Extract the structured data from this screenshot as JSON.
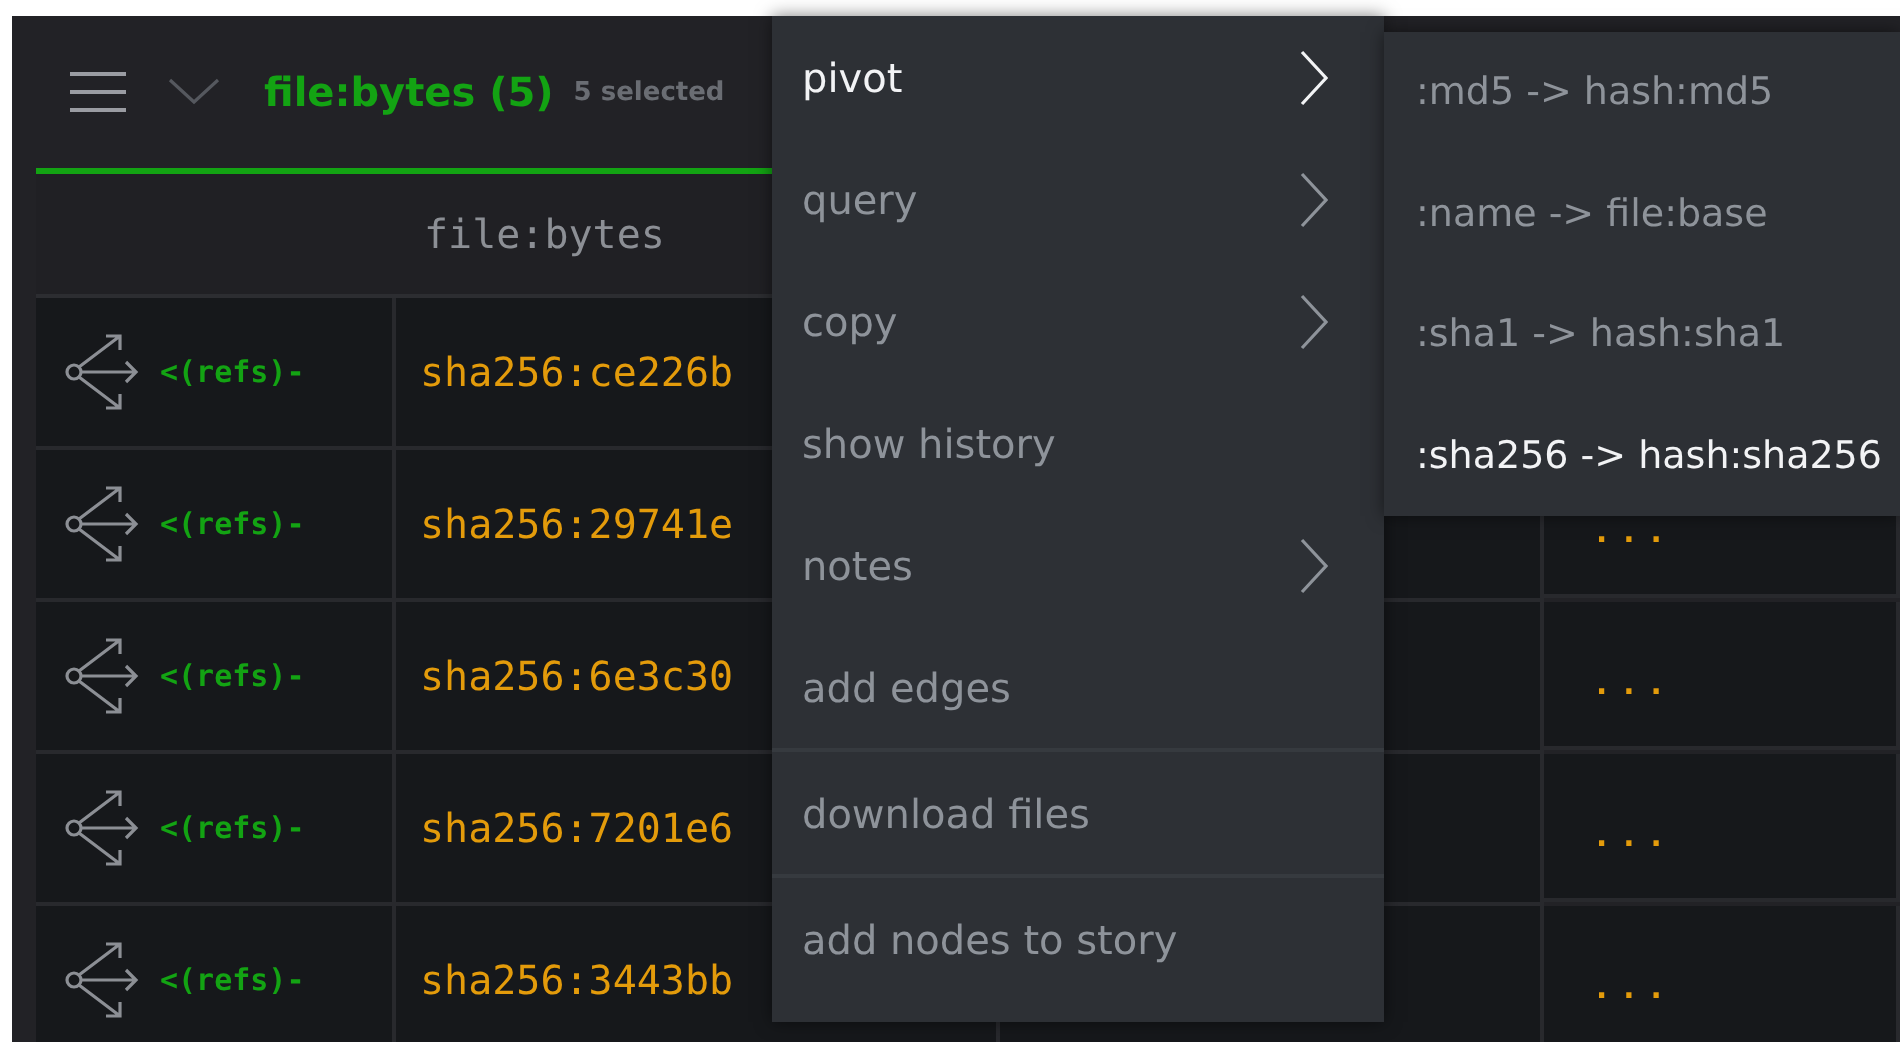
{
  "header": {
    "title": "file:bytes (5)",
    "selection": "5 selected"
  },
  "table": {
    "column_header": "file:bytes",
    "rows": [
      {
        "refs": "<(refs)-",
        "hash": "sha256:ce226b"
      },
      {
        "refs": "<(refs)-",
        "hash": "sha256:29741e",
        "more": "..."
      },
      {
        "refs": "<(refs)-",
        "hash": "sha256:6e3c30",
        "more": "..."
      },
      {
        "refs": "<(refs)-",
        "hash": "sha256:7201e6",
        "more": "..."
      },
      {
        "refs": "<(refs)-",
        "hash": "sha256:3443bb",
        "more": "..."
      }
    ]
  },
  "menu": {
    "groups": [
      {
        "items": [
          {
            "label": "pivot",
            "submenu": true,
            "selected": true
          },
          {
            "label": "query",
            "submenu": true,
            "selected": false
          },
          {
            "label": "copy",
            "submenu": true,
            "selected": false
          },
          {
            "label": "show history",
            "submenu": false,
            "selected": false
          },
          {
            "label": "notes",
            "submenu": true,
            "selected": false
          },
          {
            "label": "add edges",
            "submenu": false,
            "selected": false
          }
        ]
      },
      {
        "items": [
          {
            "label": "download files",
            "submenu": false,
            "selected": false
          }
        ]
      },
      {
        "items": [
          {
            "label": "add nodes to story",
            "submenu": false,
            "selected": false
          }
        ]
      }
    ]
  },
  "submenu": {
    "items": [
      {
        "label": ":md5 -> hash:md5",
        "selected": false
      },
      {
        "label": ":name -> file:base",
        "selected": false
      },
      {
        "label": ":sha1 -> hash:sha1",
        "selected": false
      },
      {
        "label": ":sha256 -> hash:sha256",
        "selected": true
      }
    ]
  }
}
